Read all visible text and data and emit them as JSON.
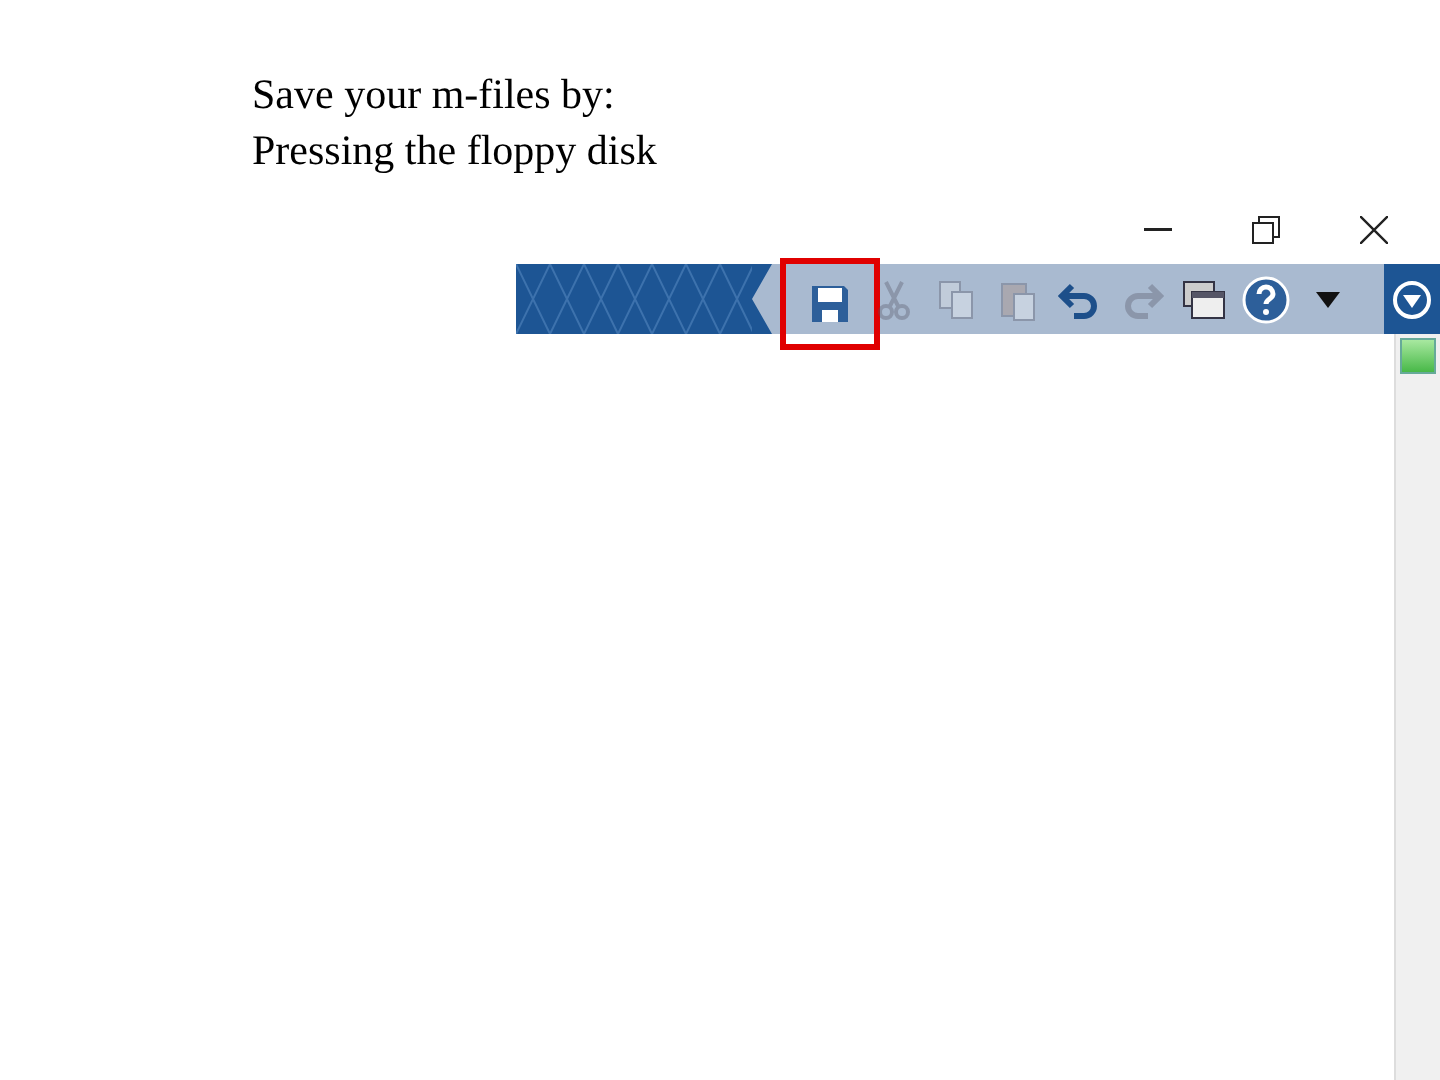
{
  "slide": {
    "lines": [
      "Save your m-files by:",
      "Pressing the floppy disk"
    ]
  },
  "toolbar": {
    "buttons": [
      {
        "kind": "save",
        "disabled": false,
        "highlighted": true
      },
      {
        "kind": "cut",
        "disabled": true,
        "highlighted": false
      },
      {
        "kind": "copy",
        "disabled": true,
        "highlighted": false
      },
      {
        "kind": "paste",
        "disabled": true,
        "highlighted": false
      },
      {
        "kind": "undo",
        "disabled": false,
        "highlighted": false
      },
      {
        "kind": "redo",
        "disabled": true,
        "highlighted": false
      },
      {
        "kind": "windows",
        "disabled": false,
        "highlighted": false
      },
      {
        "kind": "help",
        "disabled": false,
        "highlighted": false
      },
      {
        "kind": "dropdown",
        "disabled": false,
        "highlighted": false
      }
    ]
  }
}
